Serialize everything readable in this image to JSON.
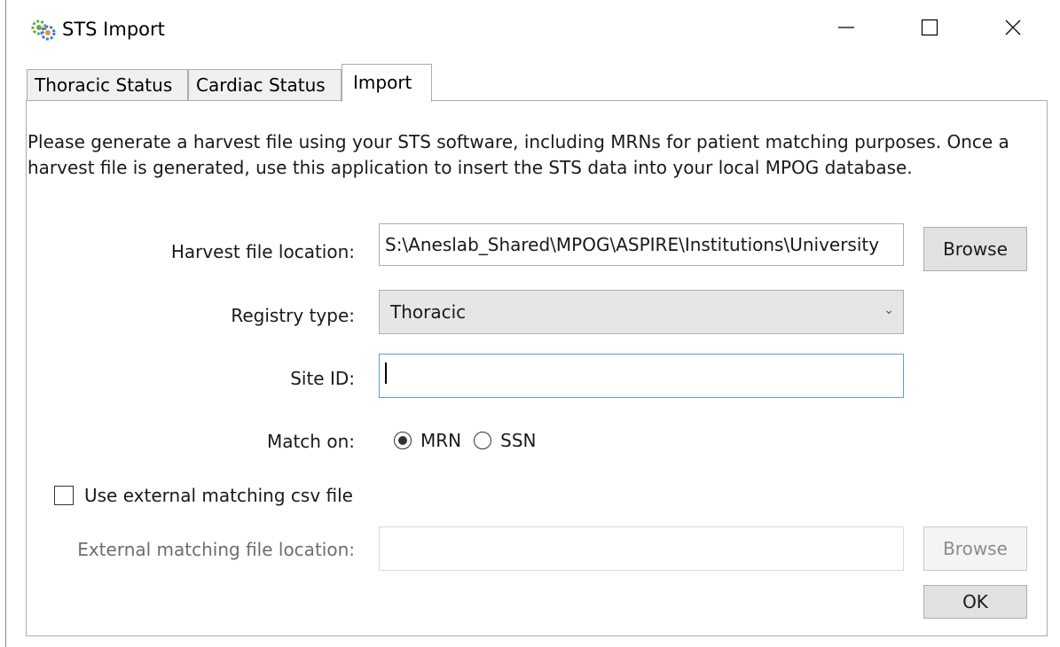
{
  "window": {
    "title": "STS Import",
    "app_icon": "sts-gear-icon",
    "controls": {
      "minimize": "minimize-icon",
      "maximize": "maximize-icon",
      "close": "close-icon"
    }
  },
  "tabs": [
    {
      "label": "Thoracic Status",
      "active": false
    },
    {
      "label": "Cardiac Status",
      "active": false
    },
    {
      "label": "Import",
      "active": true
    }
  ],
  "import": {
    "description": "Please generate a harvest file using your STS software, including MRNs for patient matching purposes. Once a harvest file is generated, use this application to insert the STS data into your local MPOG database.",
    "harvest_label": "Harvest file location:",
    "harvest_value": "S:\\Aneslab_Shared\\MPOG\\ASPIRE\\Institutions\\University",
    "browse_label": "Browse",
    "registry_label": "Registry type:",
    "registry_value": "Thoracic",
    "site_label": "Site ID:",
    "site_value": "",
    "match_label": "Match on:",
    "match_options": [
      {
        "label": "MRN",
        "checked": true
      },
      {
        "label": "SSN",
        "checked": false
      }
    ],
    "use_external_label": "Use external matching csv file",
    "use_external_checked": false,
    "external_label": "External matching file location:",
    "external_value": "",
    "external_browse_label": "Browse",
    "ok_label": "OK"
  },
  "colors": {
    "focus_border": "#5aa0d8",
    "disabled_text": "#6d6d6d",
    "button_bg": "#e1e1e1"
  }
}
